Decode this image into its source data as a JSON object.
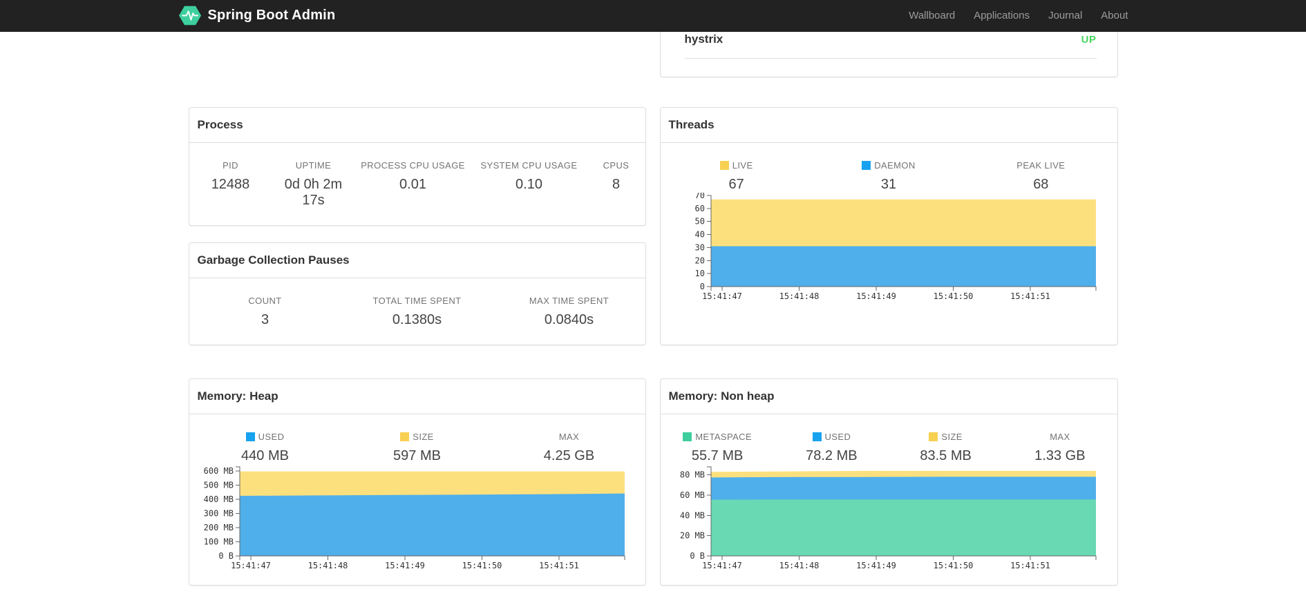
{
  "navbar": {
    "brand": "Spring Boot Admin",
    "items": [
      {
        "label": "Wallboard"
      },
      {
        "label": "Applications"
      },
      {
        "label": "Journal"
      },
      {
        "label": "About"
      }
    ]
  },
  "colors": {
    "navbar_bg": "#222222",
    "logo_green": "#3ecf9e",
    "status_up": "#45d75f",
    "panel_border": "#dddddd",
    "area_yellow": "#fde07e",
    "area_blue": "#4fafeb",
    "area_green": "#68d9b2",
    "swatch_yellow": "#f7d052",
    "swatch_blue": "#18a2ef",
    "swatch_green": "#3ecd9c"
  },
  "status_panel": {
    "app_name": "hystrix",
    "status": "UP",
    "status_color": "#45d75f"
  },
  "panels": {
    "process": {
      "title": "Process",
      "stats": [
        {
          "label": "PID",
          "value": "12488"
        },
        {
          "label": "UPTIME",
          "value": "0d 0h 2m 17s"
        },
        {
          "label": "PROCESS CPU USAGE",
          "value": "0.01"
        },
        {
          "label": "SYSTEM CPU USAGE",
          "value": "0.10"
        },
        {
          "label": "CPUS",
          "value": "8"
        }
      ]
    },
    "gc": {
      "title": "Garbage Collection Pauses",
      "stats": [
        {
          "label": "COUNT",
          "value": "3"
        },
        {
          "label": "TOTAL TIME SPENT",
          "value": "0.1380s"
        },
        {
          "label": "MAX TIME SPENT",
          "value": "0.0840s"
        }
      ]
    },
    "threads": {
      "title": "Threads",
      "stats": [
        {
          "label": "LIVE",
          "value": "67",
          "swatch": "#f7d052"
        },
        {
          "label": "DAEMON",
          "value": "31",
          "swatch": "#18a2ef"
        },
        {
          "label": "PEAK LIVE",
          "value": "68"
        }
      ],
      "chart_data": {
        "type": "area",
        "title": "Threads",
        "xlabel": "",
        "ylabel": "",
        "grid": false,
        "legend_position": "top",
        "x_ticks": [
          "15:41:47",
          "15:41:48",
          "15:41:49",
          "15:41:50",
          "15:41:51"
        ],
        "ymax": 70,
        "yticks": [
          {
            "label": "0",
            "value": 0
          },
          {
            "label": "10",
            "value": 10
          },
          {
            "label": "20",
            "value": 20
          },
          {
            "label": "30",
            "value": 30
          },
          {
            "label": "40",
            "value": 40
          },
          {
            "label": "50",
            "value": 50
          },
          {
            "label": "60",
            "value": 60
          },
          {
            "label": "70",
            "value": 70
          }
        ],
        "series": [
          {
            "name": "LIVE",
            "color": "#fde07e",
            "values": [
              67,
              67,
              67,
              67,
              67,
              67
            ]
          },
          {
            "name": "DAEMON",
            "color": "#4fafeb",
            "values": [
              31,
              31,
              31,
              31,
              31,
              31
            ]
          }
        ]
      }
    },
    "heap": {
      "title": "Memory: Heap",
      "stats": [
        {
          "label": "USED",
          "value": "440 MB",
          "swatch": "#18a2ef"
        },
        {
          "label": "SIZE",
          "value": "597 MB",
          "swatch": "#f7d052"
        },
        {
          "label": "MAX",
          "value": "4.25 GB"
        }
      ],
      "chart_data": {
        "type": "area",
        "title": "Memory: Heap",
        "xlabel": "",
        "ylabel": "",
        "grid": false,
        "legend_position": "top",
        "x_ticks": [
          "15:41:47",
          "15:41:48",
          "15:41:49",
          "15:41:50",
          "15:41:51"
        ],
        "ymax": 629,
        "yticks": [
          {
            "label": "0 B",
            "value": 0
          },
          {
            "label": "100 MB",
            "value": 100
          },
          {
            "label": "200 MB",
            "value": 200
          },
          {
            "label": "300 MB",
            "value": 300
          },
          {
            "label": "400 MB",
            "value": 400
          },
          {
            "label": "500 MB",
            "value": 500
          },
          {
            "label": "600 MB",
            "value": 600
          }
        ],
        "series": [
          {
            "name": "SIZE",
            "color": "#fde07e",
            "values": [
              597,
              597,
              597,
              597,
              597,
              597
            ]
          },
          {
            "name": "USED",
            "color": "#4fafeb",
            "values": [
              424,
              427,
              430,
              433,
              436,
              441
            ]
          }
        ]
      }
    },
    "nonheap": {
      "title": "Memory: Non heap",
      "stats": [
        {
          "label": "METASPACE",
          "value": "55.7 MB",
          "swatch": "#3ecd9c"
        },
        {
          "label": "USED",
          "value": "78.2 MB",
          "swatch": "#18a2ef"
        },
        {
          "label": "SIZE",
          "value": "83.5 MB",
          "swatch": "#f7d052"
        },
        {
          "label": "MAX",
          "value": "1.33 GB"
        }
      ],
      "chart_data": {
        "type": "area",
        "title": "Memory: Non heap",
        "xlabel": "",
        "ylabel": "",
        "grid": false,
        "legend_position": "top",
        "x_ticks": [
          "15:41:47",
          "15:41:48",
          "15:41:49",
          "15:41:50",
          "15:41:51"
        ],
        "ymax": 88,
        "yticks": [
          {
            "label": "0 B",
            "value": 0
          },
          {
            "label": "20 MB",
            "value": 20
          },
          {
            "label": "40 MB",
            "value": 40
          },
          {
            "label": "60 MB",
            "value": 60
          },
          {
            "label": "80 MB",
            "value": 80
          }
        ],
        "series": [
          {
            "name": "SIZE",
            "color": "#fde07e",
            "values": [
              83,
              83.5,
              84,
              84,
              84,
              84
            ]
          },
          {
            "name": "USED",
            "color": "#4fafeb",
            "values": [
              77.5,
              78,
              78,
              78.2,
              78.2,
              78.2
            ]
          },
          {
            "name": "METASPACE",
            "color": "#68d9b2",
            "values": [
              55.5,
              55.7,
              55.7,
              55.7,
              55.7,
              55.7
            ]
          }
        ]
      }
    }
  }
}
